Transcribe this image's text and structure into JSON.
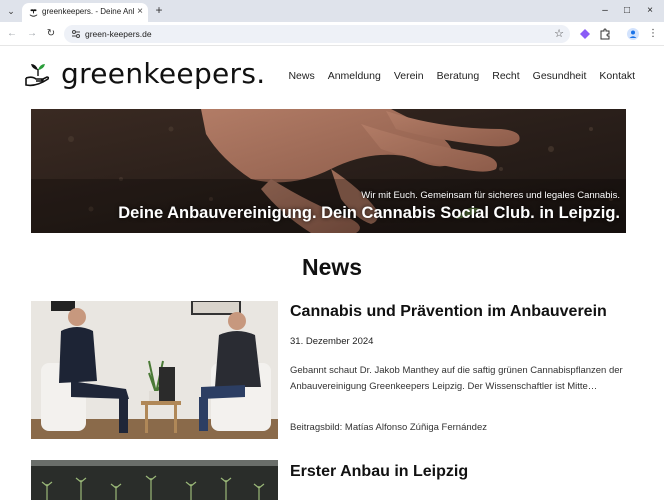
{
  "browser": {
    "tab_title": "greenkeepers. - Deine Anbauvereinigung",
    "new_tab": "+",
    "url": "green-keepers.de",
    "colors": {
      "tabbar": "#dfe3eb",
      "omnibox": "#eef1f7"
    }
  },
  "site": {
    "logo_text": "greenkeepers.",
    "nav": [
      "News",
      "Anmeldung",
      "Verein",
      "Beratung",
      "Recht",
      "Gesundheit",
      "Kontakt"
    ]
  },
  "hero": {
    "subtitle": "Wir mit Euch. Gemeinsam für sicheres und legales Cannabis.",
    "title": "Deine Anbauvereinigung. Dein Cannabis Social Club. in Leipzig."
  },
  "news": {
    "heading": "News",
    "posts": [
      {
        "title": "Cannabis und Prävention im Anbauverein",
        "date": "31. Dezember 2024",
        "excerpt": "Gebannt schaut Dr. Jakob Manthey auf die saftig grünen Cannabispflanzen der Anbauvereinigung Greenkeepers Leipzig. Der Wissenschaftler ist Mitte…",
        "credit": "Beitragsbild: Matías Alfonso Zúñiga Fernández"
      },
      {
        "title": "Erster Anbau in Leipzig"
      }
    ]
  }
}
